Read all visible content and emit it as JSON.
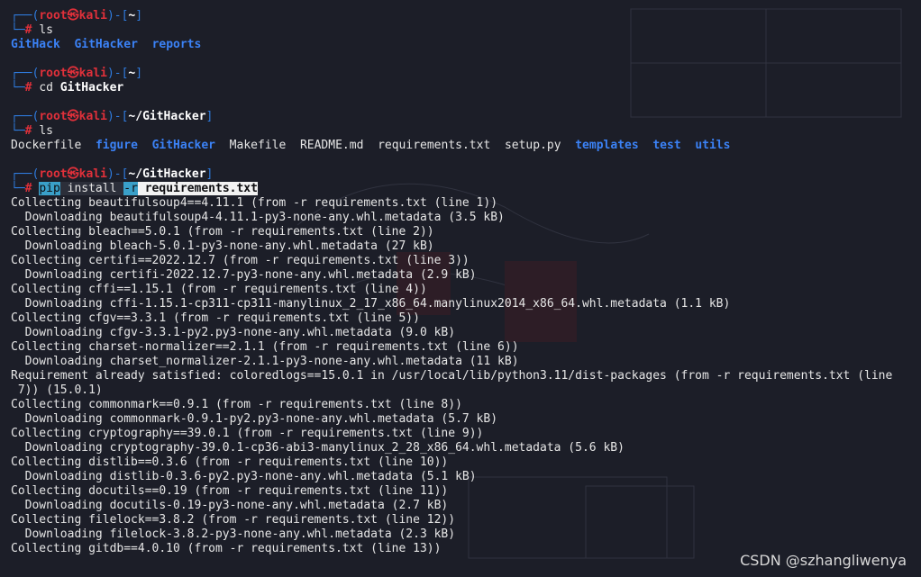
{
  "prompt": {
    "box_top": "┌──(",
    "user": "root㉿kali",
    "sep": ")-[",
    "close": "]",
    "box_bottom": "└─",
    "hash": "#"
  },
  "blocks": [
    {
      "path": "~",
      "command": "ls",
      "output_dirs": [
        "GitHack",
        "GitHacker",
        "reports"
      ]
    },
    {
      "path": "~",
      "command_prefix": "cd",
      "command_arg": "GitHacker"
    },
    {
      "path": "~/GitHacker",
      "command": "ls",
      "listing": [
        {
          "name": "Dockerfile",
          "kind": "file"
        },
        {
          "name": "figure",
          "kind": "dir"
        },
        {
          "name": "GitHacker",
          "kind": "dir"
        },
        {
          "name": "Makefile",
          "kind": "file"
        },
        {
          "name": "README.md",
          "kind": "file"
        },
        {
          "name": "requirements.txt",
          "kind": "file"
        },
        {
          "name": "setup.py",
          "kind": "file"
        },
        {
          "name": "templates",
          "kind": "dir"
        },
        {
          "name": "test",
          "kind": "dir"
        },
        {
          "name": "utils",
          "kind": "dir"
        }
      ]
    },
    {
      "path": "~/GitHacker",
      "cmd_pip": "pip",
      "cmd_install": " install ",
      "cmd_flag": "-r",
      "cmd_file": " requirements.txt"
    }
  ],
  "output_lines": [
    "Collecting beautifulsoup4==4.11.1 (from -r requirements.txt (line 1))",
    "  Downloading beautifulsoup4-4.11.1-py3-none-any.whl.metadata (3.5 kB)",
    "Collecting bleach==5.0.1 (from -r requirements.txt (line 2))",
    "  Downloading bleach-5.0.1-py3-none-any.whl.metadata (27 kB)",
    "Collecting certifi==2022.12.7 (from -r requirements.txt (line 3))",
    "  Downloading certifi-2022.12.7-py3-none-any.whl.metadata (2.9 kB)",
    "Collecting cffi==1.15.1 (from -r requirements.txt (line 4))",
    "  Downloading cffi-1.15.1-cp311-cp311-manylinux_2_17_x86_64.manylinux2014_x86_64.whl.metadata (1.1 kB)",
    "Collecting cfgv==3.3.1 (from -r requirements.txt (line 5))",
    "  Downloading cfgv-3.3.1-py2.py3-none-any.whl.metadata (9.0 kB)",
    "Collecting charset-normalizer==2.1.1 (from -r requirements.txt (line 6))",
    "  Downloading charset_normalizer-2.1.1-py3-none-any.whl.metadata (11 kB)",
    "Requirement already satisfied: coloredlogs==15.0.1 in /usr/local/lib/python3.11/dist-packages (from -r requirements.txt (line",
    " 7)) (15.0.1)",
    "Collecting commonmark==0.9.1 (from -r requirements.txt (line 8))",
    "  Downloading commonmark-0.9.1-py2.py3-none-any.whl.metadata (5.7 kB)",
    "Collecting cryptography==39.0.1 (from -r requirements.txt (line 9))",
    "  Downloading cryptography-39.0.1-cp36-abi3-manylinux_2_28_x86_64.whl.metadata (5.6 kB)",
    "Collecting distlib==0.3.6 (from -r requirements.txt (line 10))",
    "  Downloading distlib-0.3.6-py2.py3-none-any.whl.metadata (5.1 kB)",
    "Collecting docutils==0.19 (from -r requirements.txt (line 11))",
    "  Downloading docutils-0.19-py3-none-any.whl.metadata (2.7 kB)",
    "Collecting filelock==3.8.2 (from -r requirements.txt (line 12))",
    "  Downloading filelock-3.8.2-py3-none-any.whl.metadata (2.3 kB)",
    "Collecting gitdb==4.0.10 (from -r requirements.txt (line 13))"
  ],
  "watermark": "CSDN @szhangliwenya"
}
